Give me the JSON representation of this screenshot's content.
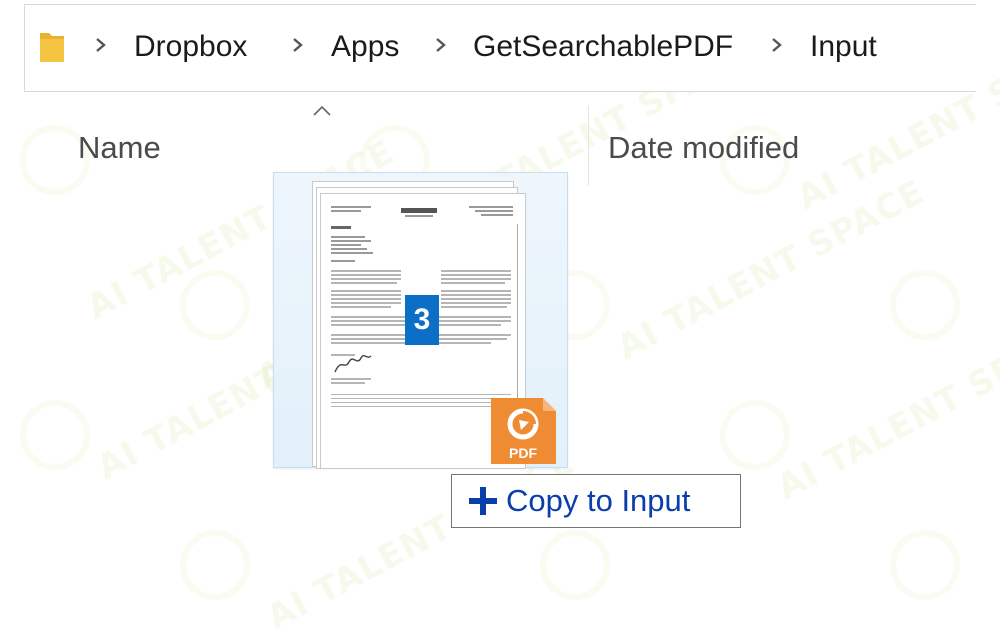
{
  "breadcrumb": {
    "items": [
      "Dropbox",
      "Apps",
      "GetSearchablePDF",
      "Input"
    ]
  },
  "columns": {
    "name": "Name",
    "date_modified": "Date modified"
  },
  "drag": {
    "item_count": "3",
    "file_type_label": "PDF",
    "tooltip": "Copy to Input"
  },
  "watermark": {
    "text": "AI TALENT SPACE",
    "color": "#b9e07a"
  },
  "colors": {
    "badge": "#0b6fc7",
    "pdf_icon": "#ef8b33",
    "tooltip_text": "#0a3ea8",
    "folder": "#f5c342"
  },
  "icons": [
    "folder-icon",
    "chevron-right-icon",
    "sort-ascending-icon",
    "pdf-file-icon",
    "plus-icon"
  ]
}
